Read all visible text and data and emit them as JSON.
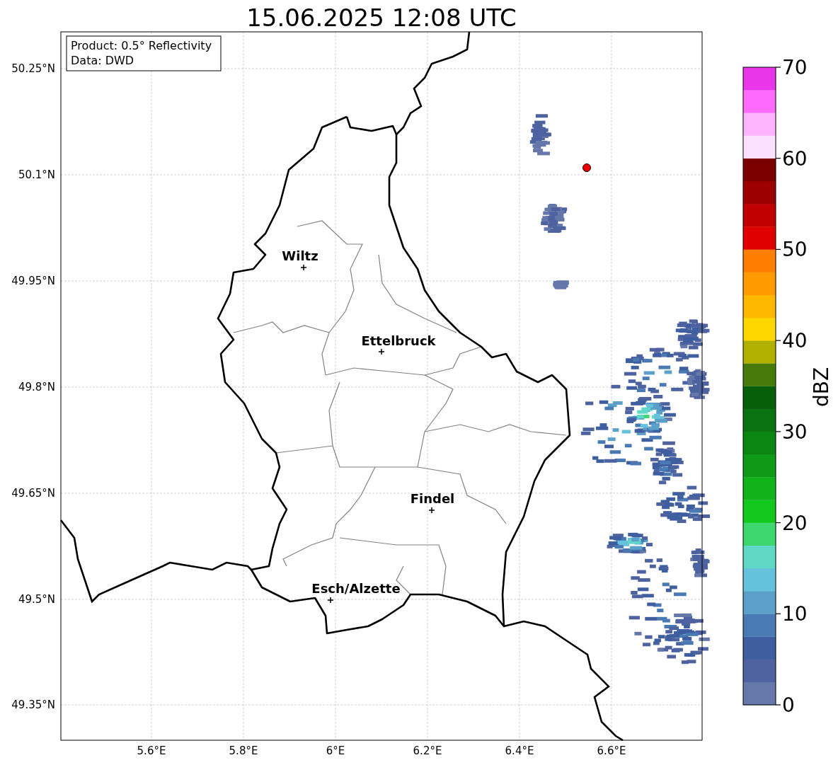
{
  "title": "15.06.2025 12:08 UTC",
  "info_box": {
    "lines": [
      "Product: 0.5° Reflectivity",
      "Data: DWD"
    ]
  },
  "map": {
    "x_ticks": [
      "5.6°E",
      "5.8°E",
      "6°E",
      "6.2°E",
      "6.4°E",
      "6.6°E"
    ],
    "y_ticks": [
      "50.25°N",
      "50.1°N",
      "49.95°N",
      "49.8°N",
      "49.65°N",
      "49.5°N",
      "49.35°N"
    ],
    "places": [
      {
        "name": "Wiltz"
      },
      {
        "name": "Ettelbruck"
      },
      {
        "name": "Findel"
      },
      {
        "name": "Esch/Alzette"
      }
    ]
  },
  "colorbar": {
    "label": "dBZ",
    "ticks": [
      "70",
      "60",
      "50",
      "40",
      "30",
      "20",
      "10",
      "0"
    ],
    "bins": [
      {
        "color": "#6677aa"
      },
      {
        "color": "#4e62a0"
      },
      {
        "color": "#3e5ea0"
      },
      {
        "color": "#4a7ab4"
      },
      {
        "color": "#5aa0c8"
      },
      {
        "color": "#66c2dc"
      },
      {
        "color": "#5fd8c8"
      },
      {
        "color": "#3ed66e"
      },
      {
        "color": "#12c81c"
      },
      {
        "color": "#10b41a"
      },
      {
        "color": "#0e9a16"
      },
      {
        "color": "#0b8613"
      },
      {
        "color": "#0a7210"
      },
      {
        "color": "#075e0b"
      },
      {
        "color": "#467a0b"
      },
      {
        "color": "#b0b000"
      },
      {
        "color": "#ffd700"
      },
      {
        "color": "#ffb700"
      },
      {
        "color": "#ff9b00"
      },
      {
        "color": "#ff7f00"
      },
      {
        "color": "#e00000"
      },
      {
        "color": "#c00000"
      },
      {
        "color": "#9c0000"
      },
      {
        "color": "#7a0000"
      },
      {
        "color": "#fde0fd"
      },
      {
        "color": "#fdb3fd"
      },
      {
        "color": "#fd6bfd"
      },
      {
        "color": "#e936e9"
      }
    ]
  }
}
